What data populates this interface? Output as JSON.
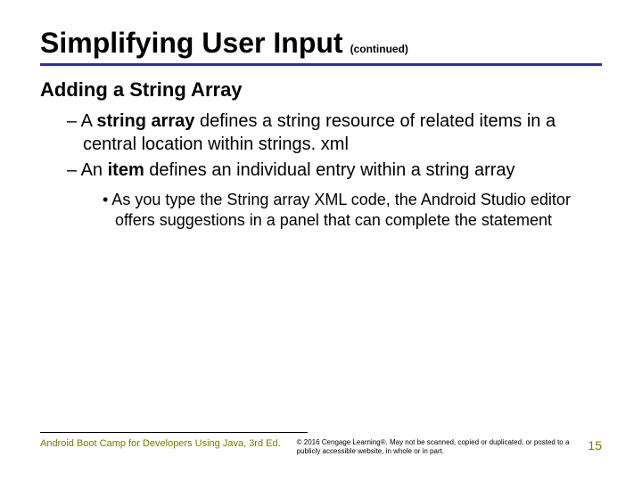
{
  "title": "Simplifying User Input",
  "continued": "(continued)",
  "subtitle": "Adding a String Array",
  "bullets": {
    "b1_pre": "– A ",
    "b1_bold": "string array",
    "b1_post": " defines a string resource of related items in a central location within strings. xml",
    "b2_pre": "– An ",
    "b2_bold": "item",
    "b2_post": " defines an individual entry within a string array",
    "sub1": "• As you type the String array XML code, the Android Studio editor offers suggestions in a panel that can complete the statement"
  },
  "footer": {
    "left": "Android Boot Camp for Developers Using Java, 3rd Ed.",
    "mid": "© 2016 Cengage Learning®. May not be scanned, copied or duplicated, or posted to a publicly accessible website, in whole or in part.",
    "page": "15"
  }
}
